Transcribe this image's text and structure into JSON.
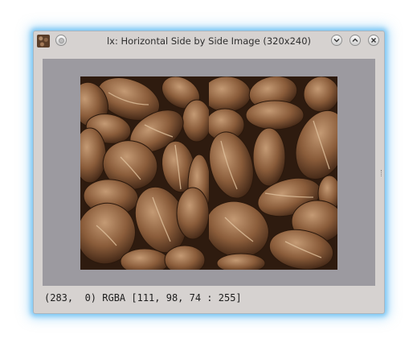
{
  "window": {
    "title": "lx: Horizontal Side by Side Image (320x240)",
    "menu_button_icon": "window-menu-icon",
    "minimize_icon": "chevron-down-icon",
    "maximize_icon": "chevron-up-icon",
    "close_icon": "close-icon"
  },
  "image": {
    "left_half": "coffee-beans-left",
    "right_half": "coffee-beans-right",
    "background_color": "#9c9aa0"
  },
  "status": {
    "text": "(283,  0) RGBA [111, 98, 74 : 255]"
  },
  "colors": {
    "window_glow": "#7ec8f5",
    "window_bg": "#d6d2d0"
  }
}
